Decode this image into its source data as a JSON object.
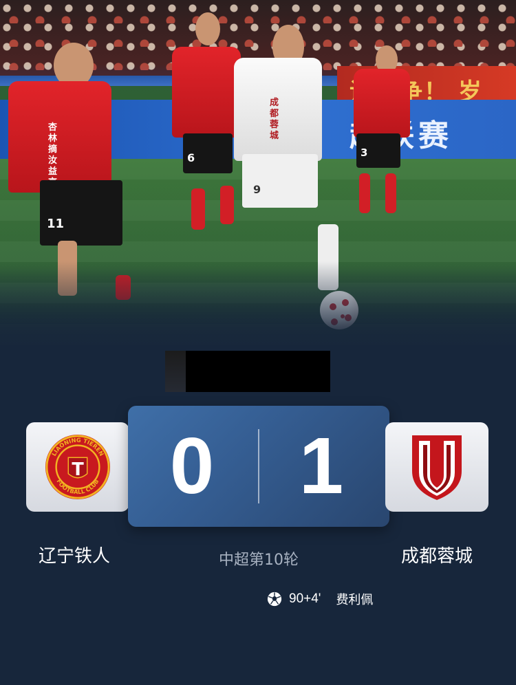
{
  "match": {
    "competition_round": "中超第10轮",
    "home": {
      "name": "辽宁铁人",
      "score": "0",
      "logo_ring_text": "LIAONING TIEREN FOOTBALL CLUB",
      "logo_letter": "T"
    },
    "away": {
      "name": "成都蓉城",
      "score": "1"
    },
    "goals": [
      {
        "minute": "90+4'",
        "scorer": "费利佩"
      }
    ]
  },
  "hero": {
    "adboard_red_text": "谁解争！ 岁月",
    "adboard_blue_text": "超联赛",
    "jerseys": {
      "home_sponsor_line1": "杏林摘汝",
      "home_sponsor_line2": "益京世界",
      "away_sponsor": "成都蓉城"
    },
    "numbers": {
      "p1": "11",
      "p2": "6",
      "p3": "9",
      "p4": "3"
    }
  },
  "colors": {
    "background": "#17263b",
    "panel": "#355e93",
    "home_red": "#c8191f",
    "away_red": "#c4161c",
    "gold": "#f2b321"
  }
}
